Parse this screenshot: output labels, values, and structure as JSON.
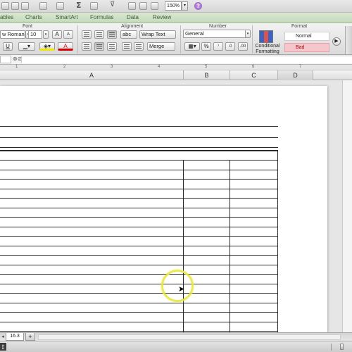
{
  "toolbar": {
    "zoom": "150%",
    "zoom_arrow": "▾",
    "help": "?",
    "sigma": "Σ",
    "filter": "⊽"
  },
  "tabs": [
    "ables",
    "Charts",
    "SmartArt",
    "Formulas",
    "Data",
    "Review"
  ],
  "ribbon": {
    "groups": {
      "font": "Font",
      "alignment": "Alignment",
      "number": "Number",
      "format": "Format"
    },
    "font_name": "w Roman",
    "font_size": "10",
    "wrap_text": "Wrap Text",
    "merge": "Merge",
    "number_format": "General",
    "conditional_formatting_line1": "Conditional",
    "conditional_formatting_line2": "Formatting",
    "style_normal": "Normal",
    "style_bad": "Bad",
    "underline": "U",
    "grow_font": "A",
    "shrink_font": "A",
    "font_color": "A",
    "percent": "%",
    "comma": "⁾",
    "abc": "abc"
  },
  "ruler": [
    "1",
    "2",
    "3",
    "4",
    "5",
    "6",
    "7"
  ],
  "columns": [
    "A",
    "B",
    "C",
    "D"
  ],
  "sheet_tab": "16.3",
  "sheet_add": "+"
}
